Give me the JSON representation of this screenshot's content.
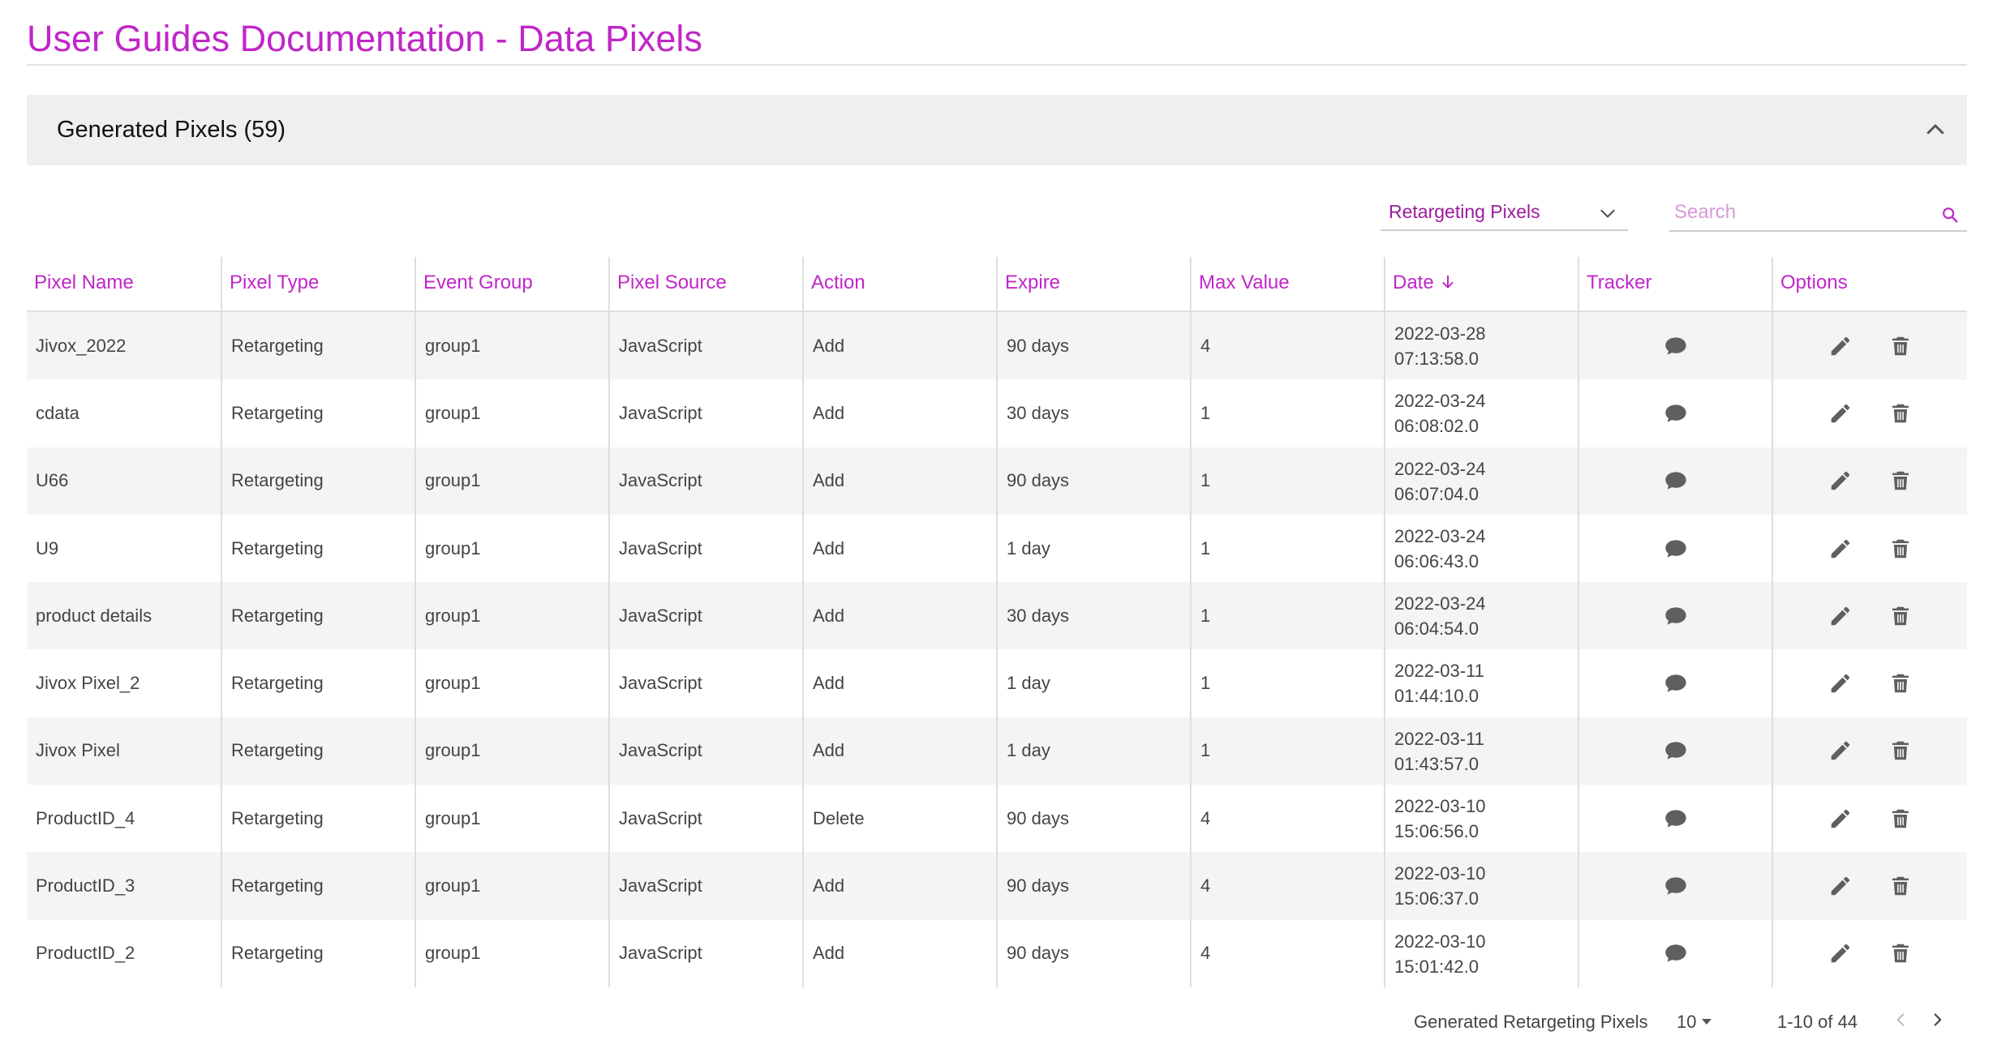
{
  "page": {
    "title": "User Guides Documentation - Data Pixels"
  },
  "panel": {
    "title": "Generated Pixels (59)"
  },
  "filter": {
    "selected": "Retargeting Pixels"
  },
  "search": {
    "placeholder": "Search"
  },
  "table": {
    "columns": [
      "Pixel Name",
      "Pixel Type",
      "Event Group",
      "Pixel Source",
      "Action",
      "Expire",
      "Max Value",
      "Date",
      "Tracker",
      "Options"
    ],
    "sorted_column": "Date",
    "sort_direction": "descending",
    "rows": [
      {
        "name": "Jivox_2022",
        "type": "Retargeting",
        "group": "group1",
        "source": "JavaScript",
        "action": "Add",
        "expire": "90 days",
        "max": "4",
        "date": "2022-03-28",
        "time": "07:13:58.0"
      },
      {
        "name": "cdata",
        "type": "Retargeting",
        "group": "group1",
        "source": "JavaScript",
        "action": "Add",
        "expire": "30 days",
        "max": "1",
        "date": "2022-03-24",
        "time": "06:08:02.0"
      },
      {
        "name": "U66",
        "type": "Retargeting",
        "group": "group1",
        "source": "JavaScript",
        "action": "Add",
        "expire": "90 days",
        "max": "1",
        "date": "2022-03-24",
        "time": "06:07:04.0"
      },
      {
        "name": "U9",
        "type": "Retargeting",
        "group": "group1",
        "source": "JavaScript",
        "action": "Add",
        "expire": "1 day",
        "max": "1",
        "date": "2022-03-24",
        "time": "06:06:43.0"
      },
      {
        "name": "product details",
        "type": "Retargeting",
        "group": "group1",
        "source": "JavaScript",
        "action": "Add",
        "expire": "30 days",
        "max": "1",
        "date": "2022-03-24",
        "time": "06:04:54.0"
      },
      {
        "name": "Jivox Pixel_2",
        "type": "Retargeting",
        "group": "group1",
        "source": "JavaScript",
        "action": "Add",
        "expire": "1 day",
        "max": "1",
        "date": "2022-03-11",
        "time": "01:44:10.0"
      },
      {
        "name": "Jivox Pixel",
        "type": "Retargeting",
        "group": "group1",
        "source": "JavaScript",
        "action": "Add",
        "expire": "1 day",
        "max": "1",
        "date": "2022-03-11",
        "time": "01:43:57.0"
      },
      {
        "name": "ProductID_4",
        "type": "Retargeting",
        "group": "group1",
        "source": "JavaScript",
        "action": "Delete",
        "expire": "90 days",
        "max": "4",
        "date": "2022-03-10",
        "time": "15:06:56.0"
      },
      {
        "name": "ProductID_3",
        "type": "Retargeting",
        "group": "group1",
        "source": "JavaScript",
        "action": "Add",
        "expire": "90 days",
        "max": "4",
        "date": "2022-03-10",
        "time": "15:06:37.0"
      },
      {
        "name": "ProductID_2",
        "type": "Retargeting",
        "group": "group1",
        "source": "JavaScript",
        "action": "Add",
        "expire": "90 days",
        "max": "4",
        "date": "2022-03-10",
        "time": "15:01:42.0"
      }
    ],
    "row_icons": {
      "tracker": "comment-icon",
      "edit": "pencil-icon",
      "delete": "trash-icon"
    }
  },
  "pagination": {
    "label": "Generated Retargeting Pixels",
    "page_size": "10",
    "range": "1-10 of 44"
  },
  "colors": {
    "accent": "#c026c8",
    "header_bg": "#efefef",
    "stripe": "#f4f4f4",
    "icon": "#5f5f5f"
  }
}
